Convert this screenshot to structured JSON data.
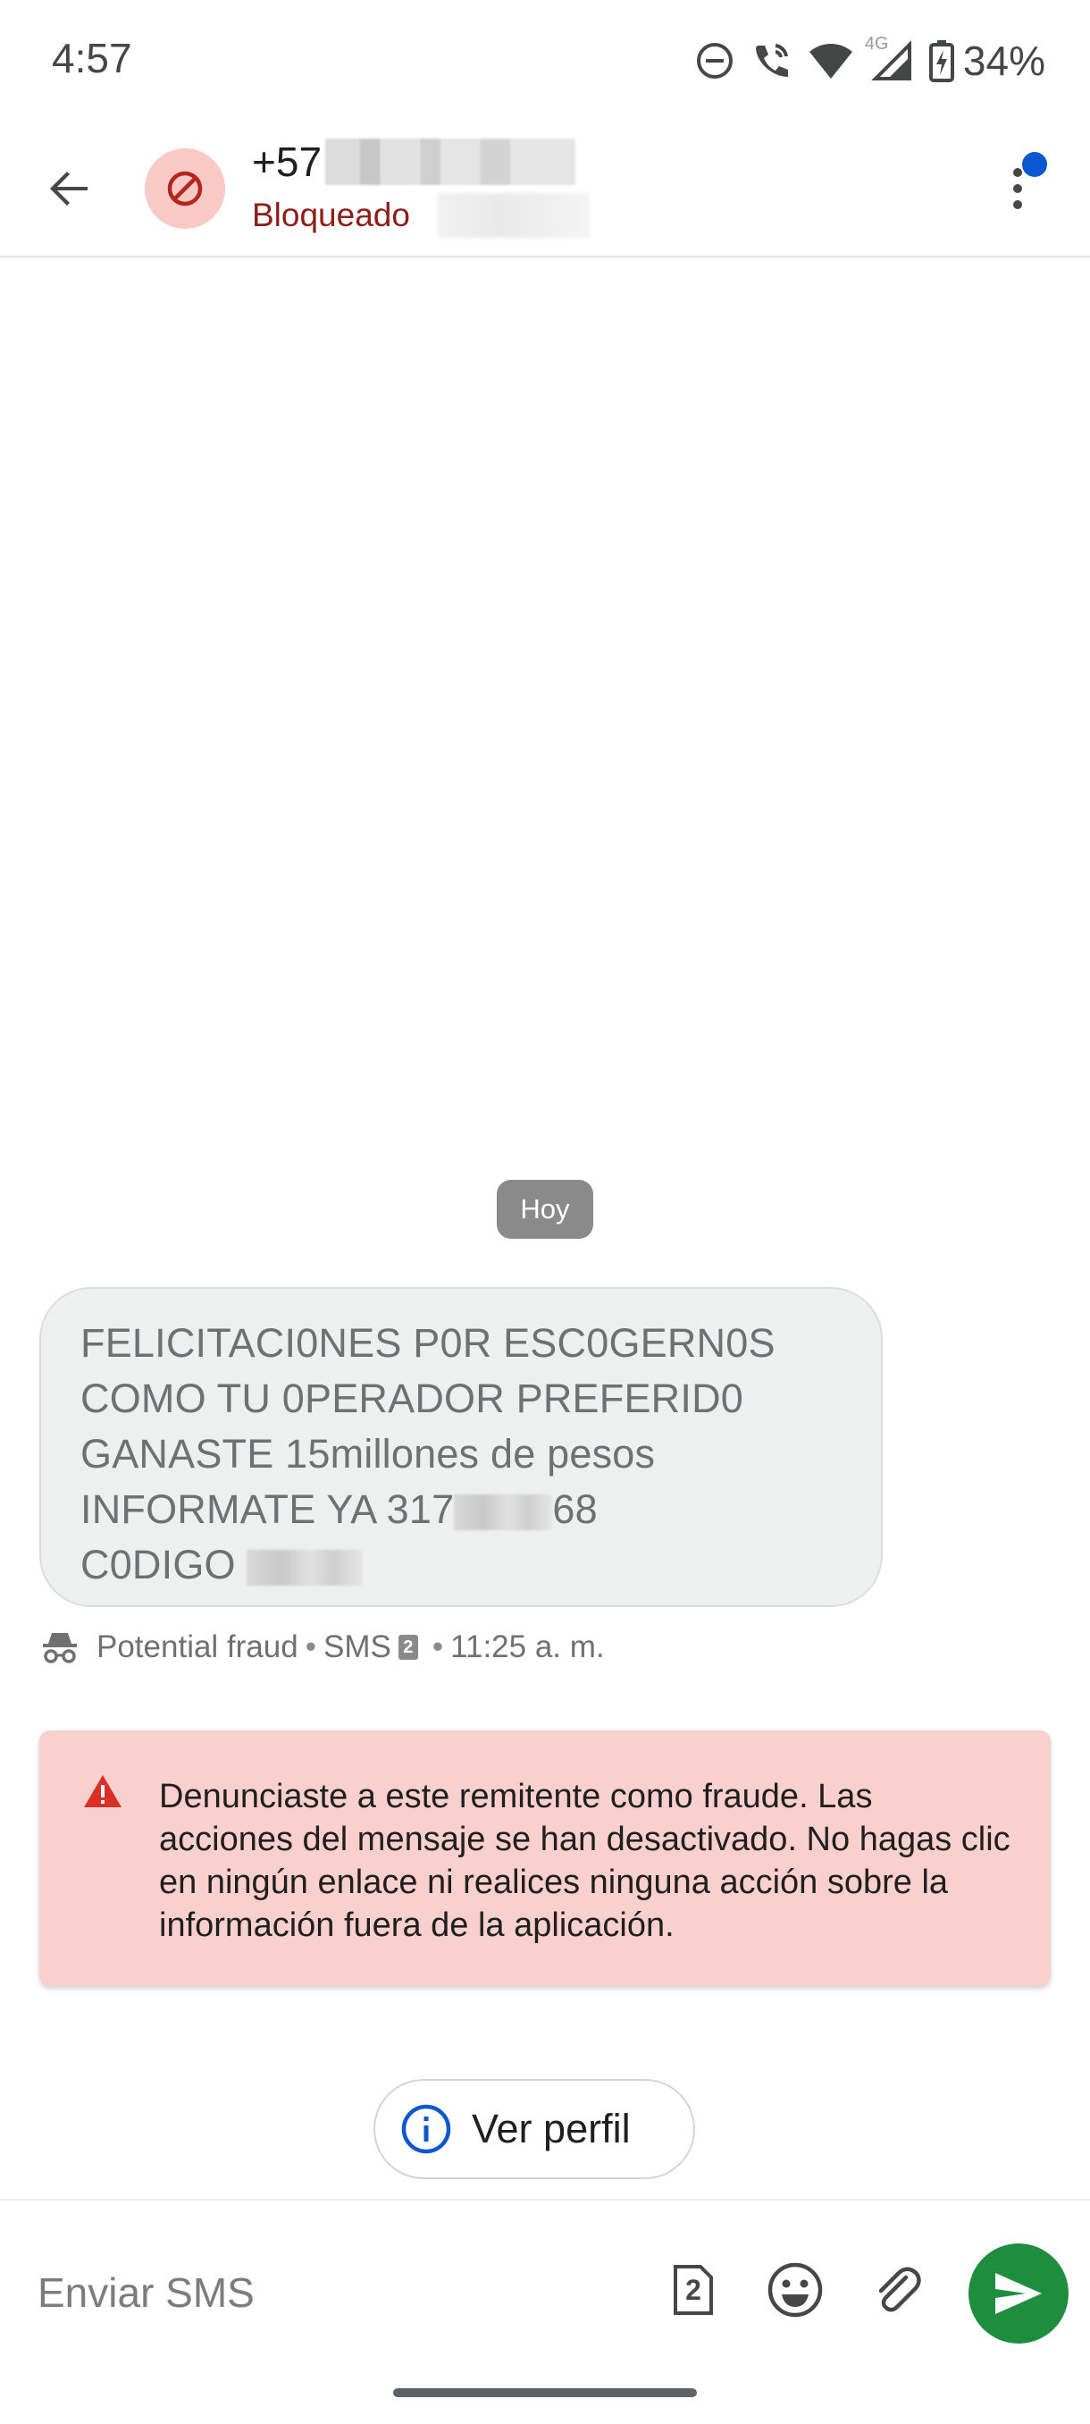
{
  "status_bar": {
    "time": "4:57",
    "network": "4G",
    "battery": "34%",
    "icons": [
      "do-not-disturb-icon",
      "wifi-calling-icon",
      "wifi-icon",
      "signal-icon",
      "battery-charging-icon"
    ]
  },
  "header": {
    "number_prefix": "+57",
    "status": "Bloqueado",
    "icons": [
      "back-arrow-icon",
      "blocked-icon",
      "more-vert-icon"
    ],
    "colors": {
      "status": "#8c1d18",
      "avatar_bg": "#f8c9c5",
      "notification_dot": "#0b57d0"
    }
  },
  "conversation": {
    "date_chip": "Hoy",
    "message": {
      "lines": [
        "FELICITACI0NES P0R ESC0GERN0S",
        "COMO TU 0PERADOR PREFERID0",
        "GANASTE 15millones de pesos",
        "INFORMATE YA 317",
        "68",
        "C0DIGO"
      ]
    },
    "meta": {
      "label": "Potential fraud",
      "channel": "SMS",
      "sim": "2",
      "separator": "•",
      "time": "11:25 a. m."
    },
    "warning": {
      "text": "Denunciaste a este remitente como fraude. Las acciones del mensaje se han desactivado. No hagas clic en ningún enlace ni realices ninguna acción sobre la información fuera de la aplicación.",
      "color": "#f9d0cd"
    },
    "profile_button": {
      "label": "Ver perfil"
    }
  },
  "compose": {
    "placeholder": "Enviar SMS",
    "sim_label": "2",
    "icons": [
      "sim-2-icon",
      "emoji-icon",
      "attach-icon",
      "send-icon"
    ],
    "send_color": "#1e8e3e"
  }
}
